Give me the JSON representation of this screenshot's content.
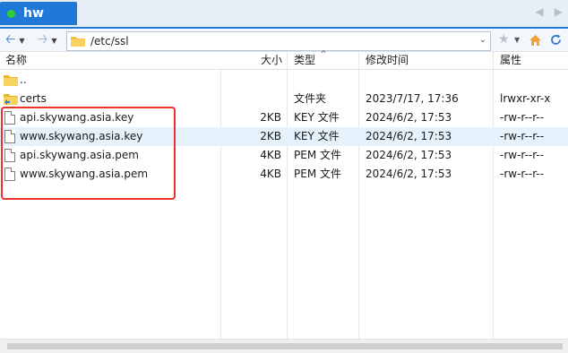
{
  "tab": {
    "label": "hw",
    "status_color": "#2fcf3a"
  },
  "toolbar": {
    "path": "/etc/ssl"
  },
  "columns": {
    "name": "名称",
    "size": "大小",
    "type": "类型",
    "modified": "修改时间",
    "attrs": "属性"
  },
  "parent_row": {
    "name": ".."
  },
  "rows": [
    {
      "name": "certs",
      "size": "",
      "type": "文件夹",
      "modified": "2023/7/17, 17:36",
      "attrs": "lrwxr-xr-x",
      "kind": "folder"
    },
    {
      "name": "api.skywang.asia.key",
      "size": "2KB",
      "type": "KEY 文件",
      "modified": "2024/6/2, 17:53",
      "attrs": "-rw-r--r--",
      "kind": "file"
    },
    {
      "name": "www.skywang.asia.key",
      "size": "2KB",
      "type": "KEY 文件",
      "modified": "2024/6/2, 17:53",
      "attrs": "-rw-r--r--",
      "kind": "file"
    },
    {
      "name": "api.skywang.asia.pem",
      "size": "4KB",
      "type": "PEM 文件",
      "modified": "2024/6/2, 17:53",
      "attrs": "-rw-r--r--",
      "kind": "file"
    },
    {
      "name": "www.skywang.asia.pem",
      "size": "4KB",
      "type": "PEM 文件",
      "modified": "2024/6/2, 17:53",
      "attrs": "-rw-r--r--",
      "kind": "file"
    }
  ],
  "colors": {
    "accent": "#1e7ad6",
    "highlight_box": "#e8322a",
    "row_hover": "#e5f1fb"
  }
}
